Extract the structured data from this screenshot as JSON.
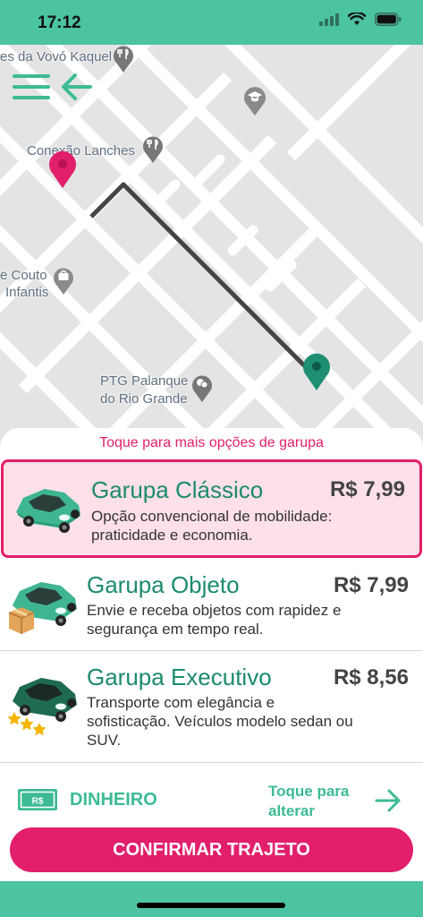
{
  "status_bar": {
    "time": "17:12"
  },
  "map": {
    "labels": {
      "vovo": "es da Vovó Kaquel",
      "conexao": "Conexão Lanches",
      "couto_1": "e Couto",
      "couto_2": "Infantis",
      "palanque_1": "PTG Palanque",
      "palanque_2": "do Rio Grande"
    }
  },
  "sheet": {
    "hint": "Toque para mais opções de garupa",
    "options": [
      {
        "title": "Garupa Clássico",
        "price": "R$ 7,99",
        "desc_1": "Opção convencional de mobilidade:",
        "desc_2": "praticidade e economia."
      },
      {
        "title": "Garupa Objeto",
        "price": "R$ 7,99",
        "desc_1": "Envie e receba objetos com rapidez e",
        "desc_2": "segurança em tempo real."
      },
      {
        "title": "Garupa Executivo",
        "price": "R$ 8,56",
        "desc_1": "Transporte com elegância e",
        "desc_2": "sofisticação. Veículos modelo sedan ou",
        "desc_3": "SUV."
      }
    ]
  },
  "payment": {
    "icon_text": "R$",
    "method": "DINHEIRO",
    "change_1": "Toque para",
    "change_2": "alterar"
  },
  "confirm_label": "CONFIRMAR TRAJETO",
  "colors": {
    "primary": "#4cc3a1",
    "accent": "#e21f6b",
    "title": "#1c8a6e"
  }
}
